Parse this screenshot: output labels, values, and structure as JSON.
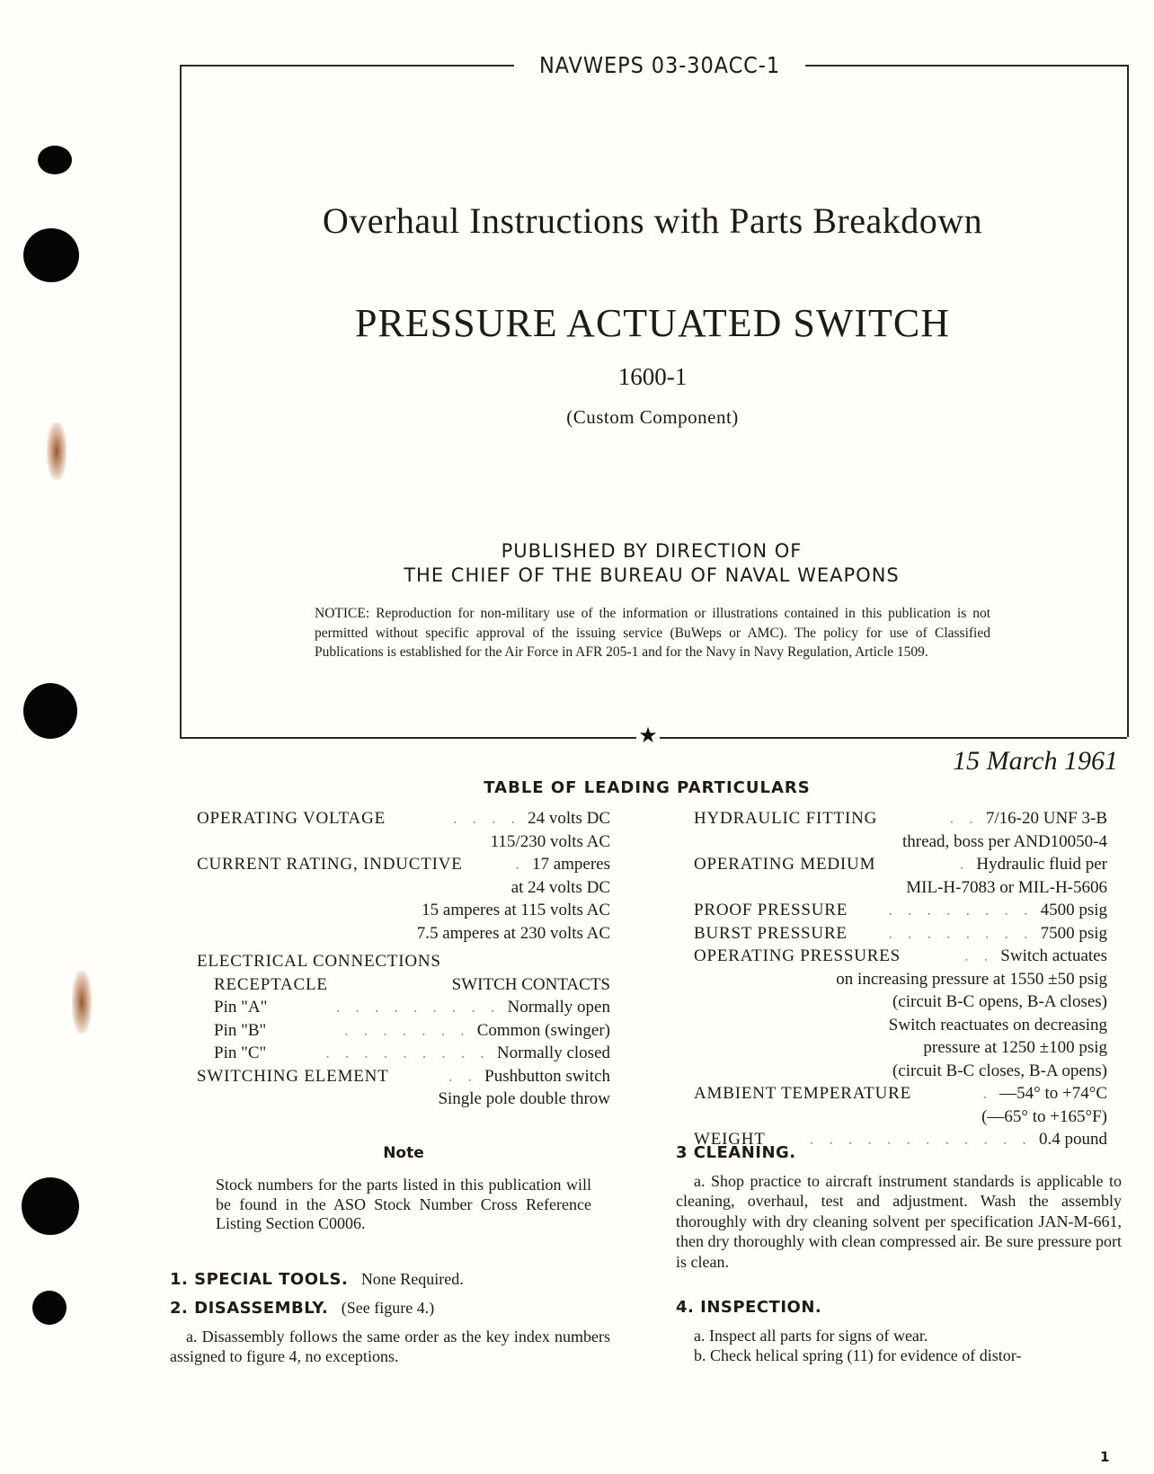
{
  "header": {
    "publication_number": "NAVWEPS 03-30ACC-1"
  },
  "cover": {
    "title": "Overhaul Instructions with Parts Breakdown",
    "subject": "PRESSURE ACTUATED SWITCH",
    "part_number": "1600-1",
    "manufacturer": "(Custom Component)",
    "published_line1": "PUBLISHED BY DIRECTION OF",
    "published_line2": "THE CHIEF OF THE BUREAU OF NAVAL WEAPONS",
    "notice": "NOTICE: Reproduction for non-military use of the information or illustrations contained in this publication is not permitted without specific approval of the issuing service (BuWeps or AMC). The policy for use of Classified Publications is established for the Air Force in AFR 205-1 and for the Navy in Navy Regulation, Article 1509.",
    "divider_icon": "star-icon"
  },
  "date": "15 March 1961",
  "leading_particulars": {
    "title": "TABLE OF LEADING PARTICULARS",
    "left": {
      "operating_voltage": {
        "label": "OPERATING VOLTAGE",
        "value": "24 volts DC",
        "cont": [
          "115/230 volts AC"
        ]
      },
      "current_rating": {
        "label": "CURRENT RATING, INDUCTIVE",
        "value": "17 amperes",
        "cont": [
          "at 24 volts DC",
          "15 amperes at 115 volts AC",
          "7.5 amperes at 230 volts AC"
        ]
      },
      "electrical_connections": {
        "label": "ELECTRICAL CONNECTIONS",
        "col_receptacle": "RECEPTACLE",
        "col_contacts": "SWITCH CONTACTS",
        "pins": [
          {
            "pin": "Pin \"A\"",
            "contact": "Normally open"
          },
          {
            "pin": "Pin \"B\"",
            "contact": "Common (swinger)"
          },
          {
            "pin": "Pin \"C\"",
            "contact": "Normally closed"
          }
        ]
      },
      "switching_element": {
        "label": "SWITCHING ELEMENT",
        "value": "Pushbutton switch",
        "cont": [
          "Single pole double throw"
        ]
      }
    },
    "right": {
      "hydraulic_fitting": {
        "label": "HYDRAULIC FITTING",
        "value": "7/16-20 UNF 3-B",
        "cont": [
          "thread, boss per AND10050-4"
        ]
      },
      "operating_medium": {
        "label": "OPERATING MEDIUM",
        "value": "Hydraulic fluid per",
        "cont": [
          "MIL-H-7083 or MIL-H-5606"
        ]
      },
      "proof_pressure": {
        "label": "PROOF PRESSURE",
        "value": "4500 psig"
      },
      "burst_pressure": {
        "label": "BURST PRESSURE",
        "value": "7500 psig"
      },
      "operating_pressures": {
        "label": "OPERATING PRESSURES",
        "value": "Switch actuates",
        "cont": [
          "on increasing pressure at 1550 ±50 psig",
          "(circuit B-C opens, B-A closes)",
          "Switch reactuates on decreasing",
          "pressure at 1250 ±100 psig",
          "(circuit B-C closes, B-A opens)"
        ]
      },
      "ambient_temperature": {
        "label": "AMBIENT TEMPERATURE",
        "value": "—54° to +74°C",
        "cont": [
          "(—65° to +165°F)"
        ]
      },
      "weight": {
        "label": "WEIGHT",
        "value": "0.4 pound"
      }
    }
  },
  "note": {
    "heading": "Note",
    "body": "Stock numbers for the parts listed in this publication will be found in the ASO Stock Number Cross Reference Listing Section C0006."
  },
  "sections": {
    "special_tools": {
      "heading": "1. SPECIAL TOOLS.",
      "text": "None Required."
    },
    "disassembly": {
      "heading": "2. DISASSEMBLY.",
      "text": "(See figure 4.)",
      "para_a": "a. Disassembly follows the same order as the key index numbers assigned to figure 4, no exceptions."
    },
    "cleaning": {
      "heading": "3 CLEANING.",
      "para_a": "a. Shop practice to aircraft instrument standards is applicable to cleaning, overhaul, test and adjustment. Wash the assembly thoroughly with dry cleaning solvent per specification JAN-M-661, then dry thoroughly with clean compressed air. Be sure pressure port is clean."
    },
    "inspection": {
      "heading": "4. INSPECTION.",
      "para_a": "a. Inspect all parts for signs of wear.",
      "para_b": "b. Check helical spring (11) for evidence of distor-"
    }
  },
  "page_number": "1"
}
